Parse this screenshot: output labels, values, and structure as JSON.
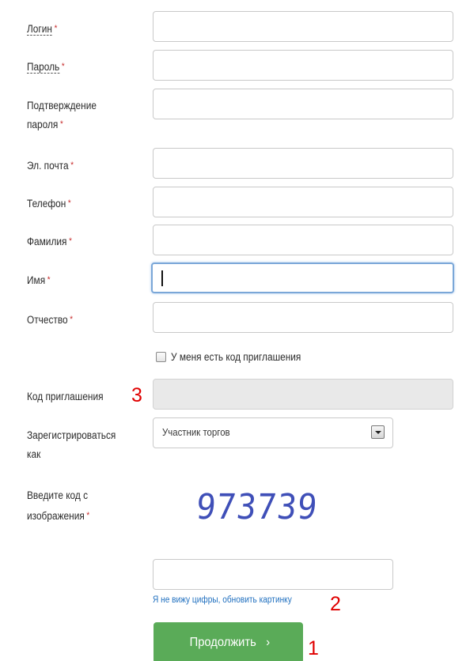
{
  "form": {
    "required_mark": "*",
    "fields": {
      "login": {
        "label": "Логин",
        "value": ""
      },
      "password": {
        "label": "Пароль",
        "value": ""
      },
      "password_confirm": {
        "label_line1": "Подтверждение",
        "label_line2": "пароля",
        "value": ""
      },
      "email": {
        "label": "Эл. почта",
        "value": ""
      },
      "phone": {
        "label": "Телефон",
        "value": ""
      },
      "last_name": {
        "label": "Фамилия",
        "value": ""
      },
      "first_name": {
        "label": "Имя",
        "value": ""
      },
      "middle_name": {
        "label": "Отчество",
        "value": ""
      }
    },
    "invite_checkbox": {
      "label": "У меня есть код приглашения",
      "checked": false
    },
    "invite_code": {
      "label": "Код приглашения",
      "value": ""
    },
    "register_as": {
      "label_line1": "Зарегистрироваться",
      "label_line2": "как",
      "selected": "Участник торгов"
    },
    "captcha": {
      "label_line1": "Введите код с",
      "label_line2": "изображения",
      "image_text": "973739",
      "value": ""
    },
    "refresh_link": "Я не вижу цифры, обновить картинку",
    "submit_label": "Продолжить",
    "submit_chevron": "›"
  },
  "annotations": {
    "marker_1": "1",
    "marker_2": "2",
    "marker_3": "3",
    "color": "#e00000"
  },
  "colors": {
    "button": "#5aab58",
    "link": "#1f6fbf",
    "required": "#c62828",
    "captcha": "#3f4fb8"
  }
}
